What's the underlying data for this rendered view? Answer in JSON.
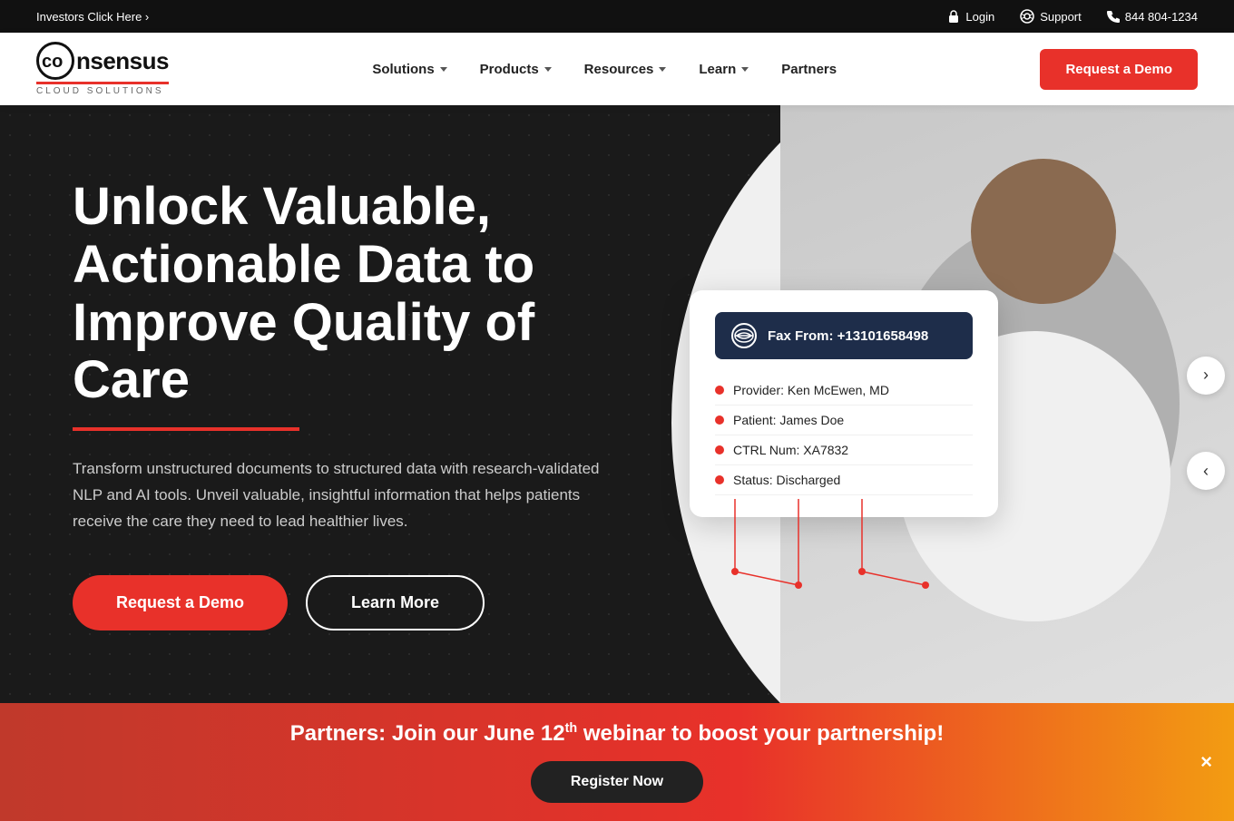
{
  "topbar": {
    "investors_text": "Investors Click Here ›",
    "login_label": "Login",
    "support_label": "Support",
    "phone": "844 804-1234"
  },
  "nav": {
    "logo_brand": "consensus",
    "logo_sub": "Cloud Solutions",
    "links": [
      {
        "label": "Solutions",
        "has_dropdown": true
      },
      {
        "label": "Products",
        "has_dropdown": true
      },
      {
        "label": "Resources",
        "has_dropdown": true
      },
      {
        "label": "Learn",
        "has_dropdown": true
      },
      {
        "label": "Partners",
        "has_dropdown": false
      }
    ],
    "cta_label": "Request a Demo"
  },
  "hero": {
    "title": "Unlock Valuable, Actionable Data to Improve Quality of Care",
    "description": "Transform unstructured documents to structured data with research-validated NLP and AI tools. Unveil valuable, insightful information that helps patients receive the care they need to lead healthier lives.",
    "btn_demo": "Request a Demo",
    "btn_learn": "Learn More"
  },
  "fax_card": {
    "header_label": "Fax From: +13101658498",
    "rows": [
      {
        "label": "Provider: Ken McEwen, MD"
      },
      {
        "label": "Patient: James Doe"
      },
      {
        "label": "CTRL Num: XA7832"
      },
      {
        "label": "Status: Discharged"
      }
    ]
  },
  "banner": {
    "text_before": "Partners: Join our June 12",
    "superscript": "th",
    "text_after": " webinar to boost your partnership!",
    "register_label": "Register Now",
    "close_label": "×"
  }
}
